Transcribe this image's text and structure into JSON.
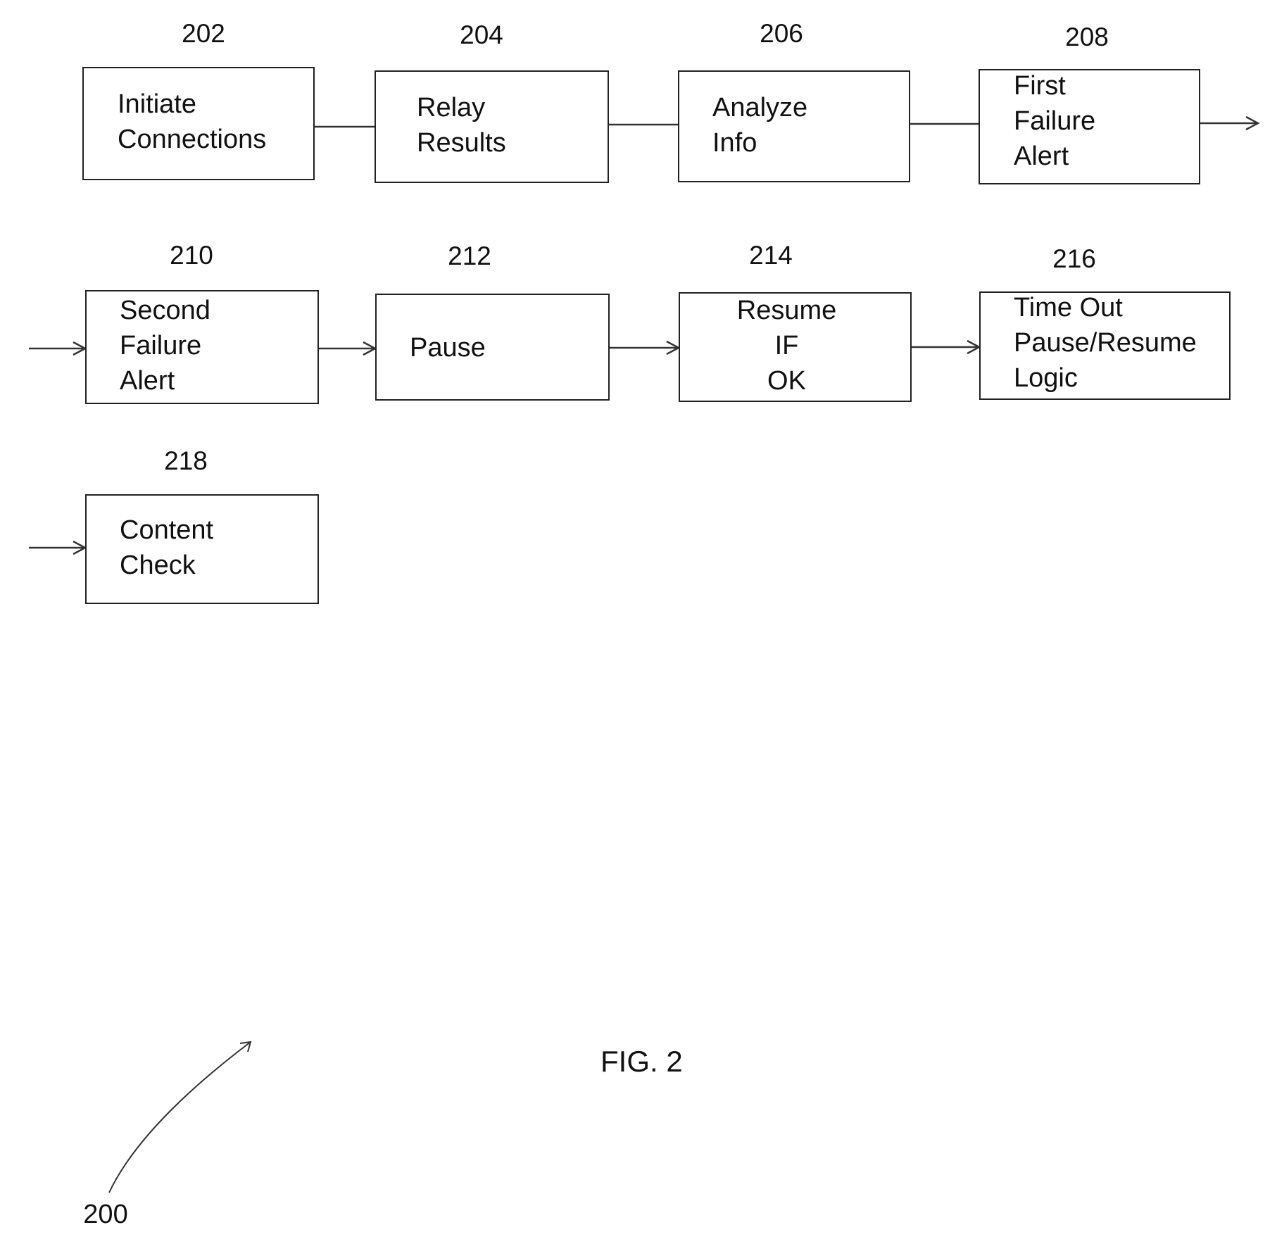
{
  "figure": {
    "caption": "FIG. 2",
    "reference": "200"
  },
  "steps": [
    {
      "ref": "202",
      "lines": [
        "Initiate",
        "Connections"
      ]
    },
    {
      "ref": "204",
      "lines": [
        "Relay",
        "Results"
      ]
    },
    {
      "ref": "206",
      "lines": [
        "Analyze",
        "Info"
      ]
    },
    {
      "ref": "208",
      "lines": [
        "First",
        "Failure",
        "Alert"
      ]
    },
    {
      "ref": "210",
      "lines": [
        "Second",
        "Failure",
        "Alert"
      ]
    },
    {
      "ref": "212",
      "lines": [
        "Pause"
      ]
    },
    {
      "ref": "214",
      "lines": [
        "Resume",
        "IF",
        "OK"
      ]
    },
    {
      "ref": "216",
      "lines": [
        "Time Out",
        "Pause/Resume",
        "Logic"
      ]
    },
    {
      "ref": "218",
      "lines": [
        "Content",
        "Check"
      ]
    }
  ],
  "step_text": {
    "202": "Initiate\nConnections",
    "204": "Relay\nResults",
    "206": "Analyze\nInfo",
    "208": "First\nFailure\nAlert",
    "210": "Second\nFailure\nAlert",
    "212": "Pause",
    "214": "Resume\nIF\nOK",
    "216": "Time Out\nPause/Resume\nLogic",
    "218": "Content\nCheck"
  }
}
